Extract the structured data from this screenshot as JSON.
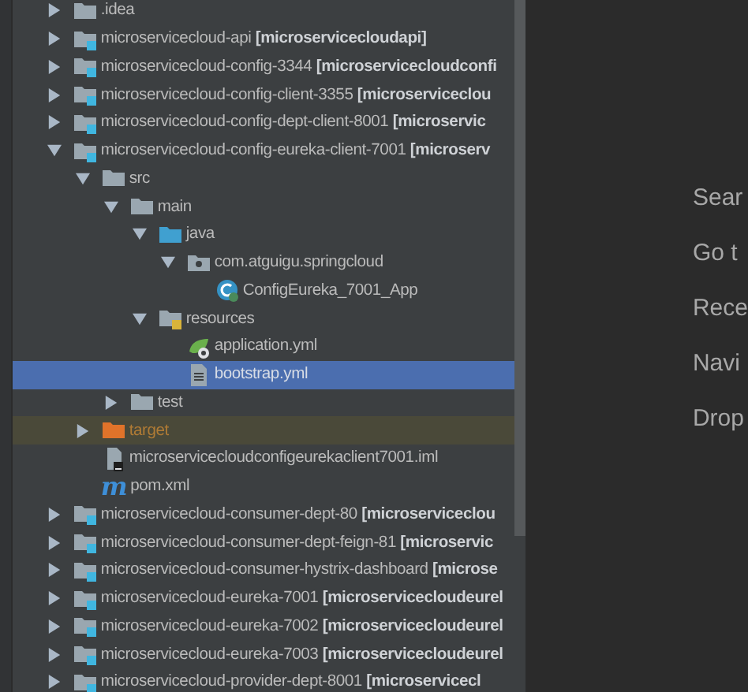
{
  "project_tree": [
    {
      "label": ".idea",
      "kind": "folder",
      "expanded": false,
      "selected": false
    },
    {
      "label": "microservicecloud-api **[microservicecloudapi]**",
      "kind": "module",
      "expanded": false,
      "selected": false
    },
    {
      "label": "microservicecloud-config-3344 **[microservicecloudconfi**",
      "kind": "module",
      "expanded": false,
      "selected": false
    },
    {
      "label": "microservicecloud-config-client-3355 **[microserviceclou**",
      "kind": "module",
      "expanded": false,
      "selected": false
    },
    {
      "label": "microservicecloud-config-dept-client-8001 **[microservic**",
      "kind": "module",
      "expanded": false,
      "selected": false
    },
    {
      "label": "microservicecloud-config-eureka-client-7001 **[microserv**",
      "kind": "module",
      "expanded": true,
      "selected": false,
      "children": [
        {
          "label": "src",
          "kind": "folder",
          "expanded": true,
          "selected": false,
          "children": [
            {
              "label": "main",
              "kind": "folder",
              "expanded": true,
              "selected": false,
              "children": [
                {
                  "label": "java",
                  "kind": "source",
                  "expanded": true,
                  "selected": false,
                  "children": [
                    {
                      "label": "com.atguigu.springcloud",
                      "kind": "package",
                      "expanded": true,
                      "selected": false,
                      "children": [
                        {
                          "label": "ConfigEureka_7001_App",
                          "kind": "class",
                          "selected": false
                        }
                      ]
                    }
                  ]
                },
                {
                  "label": "resources",
                  "kind": "resources",
                  "expanded": true,
                  "selected": false,
                  "children": [
                    {
                      "label": "application.yml",
                      "kind": "config",
                      "selected": false
                    },
                    {
                      "label": "bootstrap.yml",
                      "kind": "file",
                      "selected": true
                    }
                  ]
                }
              ]
            },
            {
              "label": "test",
              "kind": "folder",
              "expanded": false,
              "selected": false
            }
          ]
        },
        {
          "label": "target",
          "kind": "excluded",
          "expanded": false,
          "selected": false
        },
        {
          "label": "microservicecloudconfigeurekaclient7001.iml",
          "kind": "iml",
          "selected": false
        },
        {
          "label": "pom.xml",
          "kind": "maven",
          "glyph": "m",
          "selected": false
        }
      ]
    },
    {
      "label": "microservicecloud-consumer-dept-80 **[microserviceclou**",
      "kind": "module",
      "expanded": false,
      "selected": false
    },
    {
      "label": "microservicecloud-consumer-dept-feign-81 **[microservic**",
      "kind": "module",
      "expanded": false,
      "selected": false
    },
    {
      "label": "microservicecloud-consumer-hystrix-dashboard **[microse**",
      "kind": "module",
      "expanded": false,
      "selected": false
    },
    {
      "label": "microservicecloud-eureka-7001 **[microservicecloudeurel**",
      "kind": "module",
      "expanded": false,
      "selected": false
    },
    {
      "label": "microservicecloud-eureka-7002 **[microservicecloudeurel**",
      "kind": "module",
      "expanded": false,
      "selected": false
    },
    {
      "label": "microservicecloud-eureka-7003 **[microservicecloudeurel**",
      "kind": "module",
      "expanded": false,
      "selected": false
    },
    {
      "label": "microservicecloud-provider-dept-8001 **[microservicecl**",
      "kind": "module",
      "expanded": false,
      "selected": false
    }
  ],
  "editor_hints": [
    "Sear",
    "Go t",
    "Rece",
    "Navi",
    "Drop"
  ]
}
